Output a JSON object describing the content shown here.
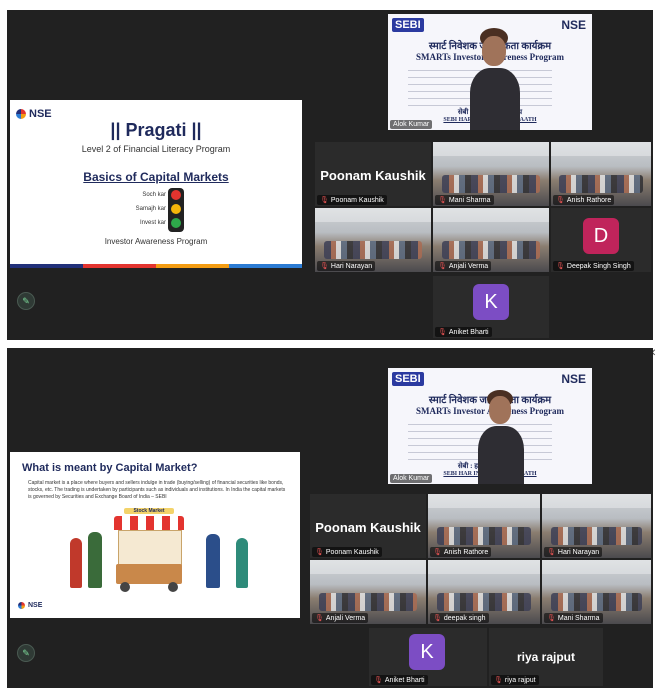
{
  "session1": {
    "slide": {
      "logo": "NSE",
      "title": "|| Pragati ||",
      "subtitle": "Level 2 of Financial Literacy Program",
      "heading": "Basics of Capital Markets",
      "signal_labels": [
        "Soch kar",
        "Samajh kar",
        "Invest kar"
      ],
      "footer": "Investor Awareness Program"
    },
    "banner": {
      "sebi": "SEBI",
      "nse": "NSE",
      "program_hindi": "स्मार्ट निवेशक जागरूकता कार्यक्रम",
      "program_english": "SMARTs Investor Awareness Program",
      "footer_hindi": "सेबी : हर निवेशक के साथ",
      "footer_english": "SEBI HAR INVESTOR KE SAATH",
      "speaker": "Alok Kumar"
    },
    "tiles": {
      "poonam_big": "Poonam Kaushik",
      "poonam": "Poonam Kaushik",
      "mani": "Mani Sharma",
      "anish": "Anish Rathore",
      "hari": "Hari Narayan",
      "anjali": "Anjali Verma",
      "deepak": "Deepak Singh Singh",
      "deepak_initial": "D",
      "aniket": "Aniket Bharti",
      "aniket_initial": "K"
    }
  },
  "session2": {
    "slide": {
      "title": "What is meant by Capital Market?",
      "body": "Capital market is a place where buyers and sellers indulge in trade (buying/selling) of financial securities like bonds, stocks, etc. The trading is undertaken by participants such as individuals and institutions. In India the capital markets is governed by Securities and Exchange Board of India – SEBI",
      "stall_sign": "Stock Market",
      "logo": "NSE"
    },
    "banner": {
      "sebi": "SEBI",
      "nse": "NSE",
      "program_hindi": "स्मार्ट निवेशक जागरूकता कार्यक्रम",
      "program_english": "SMARTs Investor Awareness Program",
      "footer_hindi": "सेबी : हर निवेशक के साथ",
      "footer_english": "SEBI HAR INVESTOR KE SAATH",
      "speaker": "Alok Kumar"
    },
    "tiles": {
      "poonam_big": "Poonam Kaushik",
      "poonam": "Poonam Kaushik",
      "anish": "Anish Rathore",
      "hari": "Hari Narayan",
      "anjali": "Anjali Verma",
      "deepak": "deepak singh",
      "mani": "Mani Sharma",
      "aniket": "Aniket Bharti",
      "aniket_initial": "K",
      "riya_big": "riya rajput",
      "riya": "riya rajput"
    }
  },
  "window_controls": {
    "minimize": "–",
    "maximize": "❐",
    "close": "✕"
  },
  "colors": {
    "avatar_d": "#c0245b",
    "avatar_k": "#7c4dc4",
    "muted_mic": "#e05151"
  }
}
